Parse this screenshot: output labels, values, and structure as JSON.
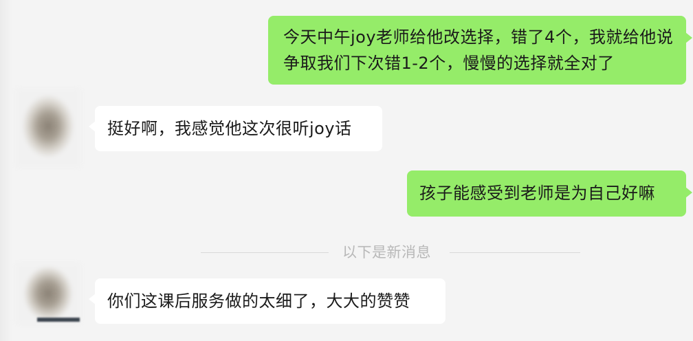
{
  "messages": [
    {
      "direction": "out",
      "text": "今天中午joy老师给他改选择，错了4个，我就给他说争取我们下次错1-2个，慢慢的选择就全对了"
    },
    {
      "direction": "in",
      "text": "挺好啊，我感觉他这次很听joy话"
    },
    {
      "direction": "out",
      "text": "孩子能感受到老师是为自己好嘛"
    },
    {
      "direction": "in",
      "text": "你们这课后服务做的太细了，大大的赞赞"
    }
  ],
  "divider": {
    "text": "以下是新消息"
  },
  "colors": {
    "background": "#f4f4f4",
    "outgoing_bubble": "#95ec69",
    "incoming_bubble": "#ffffff",
    "divider_text": "#b8b8b8"
  }
}
